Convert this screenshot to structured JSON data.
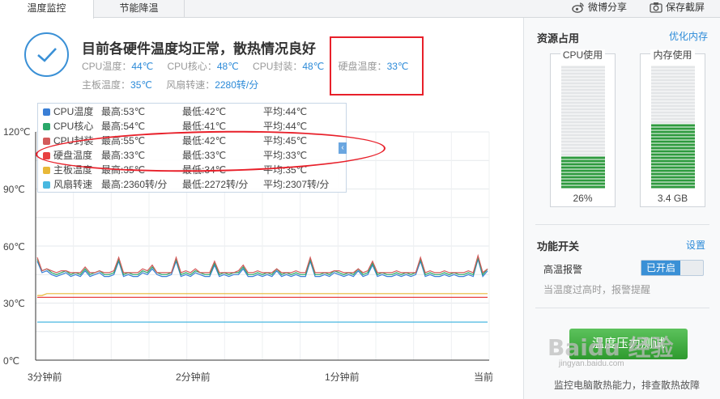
{
  "tabs": [
    {
      "label": "温度监控",
      "active": true
    },
    {
      "label": "节能降温",
      "active": false
    }
  ],
  "toolbar": {
    "weibo_share": "微博分享",
    "save_screenshot": "保存截屏"
  },
  "status": {
    "title": "目前各硬件温度均正常，散热情况良好",
    "stats": [
      {
        "label": "CPU温度：",
        "value": "44℃"
      },
      {
        "label": "CPU核心：",
        "value": "48℃"
      },
      {
        "label": "CPU封装：",
        "value": "48℃"
      },
      {
        "label": "硬盘温度：",
        "value": "33℃"
      },
      {
        "label": "主板温度：",
        "value": "35℃"
      },
      {
        "label": "风扇转速：",
        "value": "2280转/分"
      }
    ]
  },
  "legend": [
    {
      "name": "CPU温度",
      "max": "最高:53℃",
      "min": "最低:42℃",
      "avg": "平均:44℃",
      "color": "#3a7fd6"
    },
    {
      "name": "CPU核心",
      "max": "最高:54℃",
      "min": "最低:41℃",
      "avg": "平均:44℃",
      "color": "#2aa86a"
    },
    {
      "name": "CPU封装",
      "max": "最高:55℃",
      "min": "最低:42℃",
      "avg": "平均:45℃",
      "color": "#d35a5a"
    },
    {
      "name": "硬盘温度",
      "max": "最高:33℃",
      "min": "最低:33℃",
      "avg": "平均:33℃",
      "color": "#e84040"
    },
    {
      "name": "主板温度",
      "max": "最高:35℃",
      "min": "最低:34℃",
      "avg": "平均:35℃",
      "color": "#e8b838"
    },
    {
      "name": "风扇转速",
      "max": "最高:2360转/分",
      "min": "最低:2272转/分",
      "avg": "平均:2307转/分",
      "color": "#48b8e0"
    }
  ],
  "chart_data": {
    "type": "line",
    "y_ticks": [
      "120℃",
      "90℃",
      "60℃",
      "30℃",
      "0℃"
    ],
    "x_ticks": [
      "3分钟前",
      "2分钟前",
      "1分钟前",
      "当前"
    ],
    "ylim": [
      0,
      120
    ],
    "grid": true,
    "series": [
      {
        "name": "CPU温度",
        "color": "#3a7fd6",
        "values": [
          52,
          46,
          47,
          45,
          44,
          45,
          46,
          44,
          45,
          44,
          47,
          44,
          45,
          46,
          44,
          44,
          45,
          52,
          44,
          45,
          44,
          44,
          46,
          45,
          48,
          45,
          44,
          44,
          45,
          52,
          44,
          45,
          44,
          46,
          45,
          44,
          44,
          50,
          44,
          45,
          44,
          45,
          45,
          48,
          44,
          44,
          45,
          44,
          45,
          44,
          47,
          44,
          45,
          44,
          45,
          44,
          44,
          52,
          44,
          44,
          45,
          44,
          46,
          45,
          44,
          45,
          44,
          47,
          44,
          45,
          50,
          44,
          45,
          44,
          44,
          45,
          44,
          45,
          44,
          45,
          52,
          44,
          45,
          44,
          44,
          45,
          44,
          45,
          44,
          44,
          45,
          44,
          53,
          44,
          47
        ]
      },
      {
        "name": "CPU核心",
        "color": "#2aa86a",
        "values": [
          53,
          47,
          48,
          46,
          45,
          46,
          47,
          45,
          46,
          45,
          48,
          45,
          46,
          47,
          45,
          45,
          46,
          53,
          45,
          46,
          45,
          45,
          47,
          46,
          49,
          46,
          45,
          45,
          46,
          53,
          45,
          46,
          45,
          47,
          46,
          45,
          45,
          51,
          45,
          46,
          45,
          46,
          46,
          49,
          45,
          45,
          46,
          45,
          46,
          45,
          48,
          45,
          46,
          45,
          46,
          45,
          45,
          53,
          45,
          45,
          46,
          45,
          47,
          46,
          45,
          46,
          45,
          48,
          45,
          46,
          51,
          45,
          46,
          45,
          45,
          46,
          45,
          46,
          45,
          46,
          53,
          45,
          46,
          45,
          45,
          46,
          45,
          46,
          45,
          45,
          46,
          45,
          54,
          45,
          48
        ]
      },
      {
        "name": "CPU封装",
        "color": "#d35a5a",
        "values": [
          54,
          47,
          48,
          47,
          46,
          47,
          47,
          46,
          46,
          46,
          49,
          46,
          46,
          47,
          46,
          46,
          47,
          54,
          46,
          46,
          46,
          46,
          48,
          47,
          50,
          46,
          46,
          46,
          46,
          54,
          46,
          47,
          46,
          48,
          46,
          46,
          46,
          52,
          46,
          46,
          46,
          46,
          47,
          50,
          46,
          46,
          47,
          46,
          46,
          46,
          48,
          46,
          46,
          46,
          47,
          46,
          46,
          54,
          46,
          46,
          46,
          46,
          47,
          47,
          46,
          46,
          46,
          48,
          46,
          47,
          52,
          46,
          46,
          46,
          46,
          47,
          46,
          46,
          46,
          46,
          54,
          46,
          47,
          46,
          46,
          47,
          46,
          46,
          46,
          46,
          47,
          46,
          55,
          46,
          48
        ]
      },
      {
        "name": "硬盘温度",
        "color": "#e84040",
        "values": [
          33,
          33,
          33,
          33,
          33,
          33,
          33,
          33,
          33,
          33,
          33,
          33,
          33,
          33,
          33,
          33,
          33,
          33,
          33,
          33,
          33,
          33,
          33,
          33,
          33,
          33,
          33,
          33,
          33,
          33,
          33,
          33,
          33,
          33,
          33,
          33,
          33,
          33,
          33,
          33,
          33,
          33,
          33,
          33,
          33,
          33,
          33,
          33,
          33,
          33,
          33,
          33,
          33,
          33,
          33,
          33,
          33,
          33,
          33,
          33,
          33,
          33,
          33,
          33,
          33,
          33,
          33,
          33,
          33,
          33,
          33,
          33,
          33,
          33,
          33,
          33,
          33,
          33,
          33,
          33,
          33,
          33,
          33,
          33,
          33,
          33,
          33,
          33,
          33,
          33,
          33,
          33,
          33,
          33,
          33
        ]
      },
      {
        "name": "主板温度",
        "color": "#e8b838",
        "values": [
          34,
          34,
          35,
          35,
          35,
          35,
          35,
          35,
          35,
          35,
          35,
          35,
          35,
          35,
          35,
          35,
          35,
          35,
          35,
          35,
          35,
          35,
          35,
          35,
          35,
          35,
          35,
          35,
          35,
          35,
          35,
          35,
          35,
          35,
          35,
          35,
          35,
          35,
          35,
          35,
          35,
          35,
          35,
          35,
          35,
          35,
          35,
          35,
          35,
          35,
          35,
          35,
          35,
          35,
          35,
          35,
          35,
          35,
          35,
          35,
          35,
          35,
          35,
          35,
          35,
          35,
          35,
          35,
          35,
          35,
          35,
          35,
          35,
          35,
          35,
          35,
          35,
          35,
          35,
          35,
          35,
          35,
          35,
          35,
          35,
          35,
          35,
          35,
          35,
          35,
          35,
          35,
          35,
          35,
          35
        ]
      },
      {
        "name": "风扇转速",
        "color": "#48b8e0",
        "values": [
          20,
          20,
          20,
          20,
          20,
          20,
          20,
          20,
          20,
          20,
          20,
          20,
          20,
          20,
          20,
          20,
          20,
          20,
          20,
          20,
          20,
          20,
          20,
          20,
          20,
          20,
          20,
          20,
          20,
          20,
          20,
          20,
          20,
          20,
          20,
          20,
          20,
          20,
          20,
          20,
          20,
          20,
          20,
          20,
          20,
          20,
          20,
          20,
          20,
          20,
          20,
          20,
          20,
          20,
          20,
          20,
          20,
          20,
          20,
          20,
          20,
          20,
          20,
          20,
          20,
          20,
          20,
          20,
          20,
          20,
          20,
          20,
          20,
          20,
          20,
          20,
          20,
          20,
          20,
          20,
          20,
          20,
          20,
          20,
          20,
          20,
          20,
          20,
          20,
          20,
          20,
          20,
          20,
          20,
          20
        ]
      }
    ]
  },
  "resources": {
    "title": "资源占用",
    "optimize_link": "优化内存",
    "cpu": {
      "label": "CPU使用",
      "value": "26%",
      "fill": 0.26
    },
    "memory": {
      "label": "内存使用",
      "value": "3.4 GB",
      "fill": 0.53
    }
  },
  "functions": {
    "title": "功能开关",
    "settings_link": "设置",
    "alarm_label": "高温报警",
    "alarm_state": "已开启",
    "alarm_desc": "当温度过高时，报警提醒"
  },
  "test_button": "温度压力测试",
  "footer_note": "监控电脑散热能力，排查散热故障",
  "watermark": {
    "text": "Baidu 经验",
    "sub": "jingyan.baidu.com"
  },
  "colors": {
    "accent": "#3a90d6",
    "annotation": "#e8202a",
    "meter_green": "#2e9a3e"
  }
}
